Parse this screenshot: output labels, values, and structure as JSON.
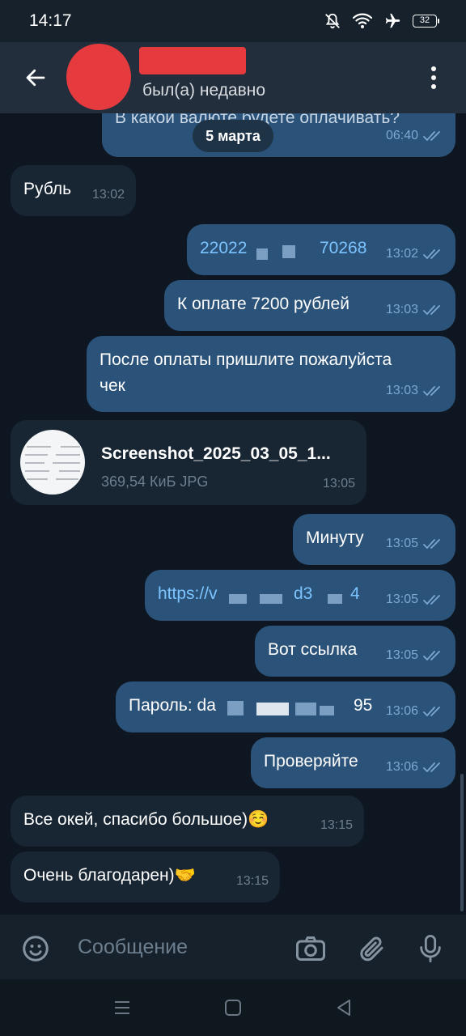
{
  "status_bar": {
    "time": "14:17",
    "battery": "32"
  },
  "header": {
    "status": "был(а) недавно"
  },
  "date_divider": "5 марта",
  "cut_message": {
    "text": "В какой валюте будете оплачивать?",
    "time": "06:40"
  },
  "messages": [
    {
      "text": "Рубль",
      "time": "13:02",
      "dir": "in"
    },
    {
      "text_start": "22022",
      "text_end": "70268",
      "time": "13:02",
      "dir": "out"
    },
    {
      "text": "К оплате 7200 рублей",
      "time": "13:03",
      "dir": "out"
    },
    {
      "line1": "После оплаты пришлите пожалуйста",
      "line2": "чек",
      "time": "13:03",
      "dir": "out"
    },
    {
      "file_name": "Screenshot_2025_03_05_1...",
      "file_size": "369,54 КиБ JPG",
      "time": "13:05",
      "dir": "in"
    },
    {
      "text": "Минуту",
      "time": "13:05",
      "dir": "out"
    },
    {
      "text_start": "https://v",
      "text_mid": "d3",
      "text_end": "4",
      "time": "13:05",
      "dir": "out"
    },
    {
      "text": "Вот ссылка",
      "time": "13:05",
      "dir": "out"
    },
    {
      "text_start": "Пароль: da",
      "text_end": "95",
      "time": "13:06",
      "dir": "out"
    },
    {
      "text": "Проверяйте",
      "time": "13:06",
      "dir": "out"
    },
    {
      "text": "Все окей, спасибо большое)☺️",
      "time": "13:15",
      "dir": "in"
    },
    {
      "text": "Очень благодарен)🤝",
      "time": "13:15",
      "dir": "in"
    }
  ],
  "input": {
    "placeholder": "Сообщение"
  },
  "icons": [
    "back-arrow-icon",
    "more-vert-icon",
    "emoji-icon",
    "camera-icon",
    "attach-icon",
    "mic-icon",
    "menu-icon",
    "home-icon",
    "back-icon"
  ],
  "colors": {
    "bg": "#0e1621",
    "incoming": "#182533",
    "outgoing": "#2b5278",
    "link": "#7cc4ff",
    "check": "#7da8d3"
  }
}
